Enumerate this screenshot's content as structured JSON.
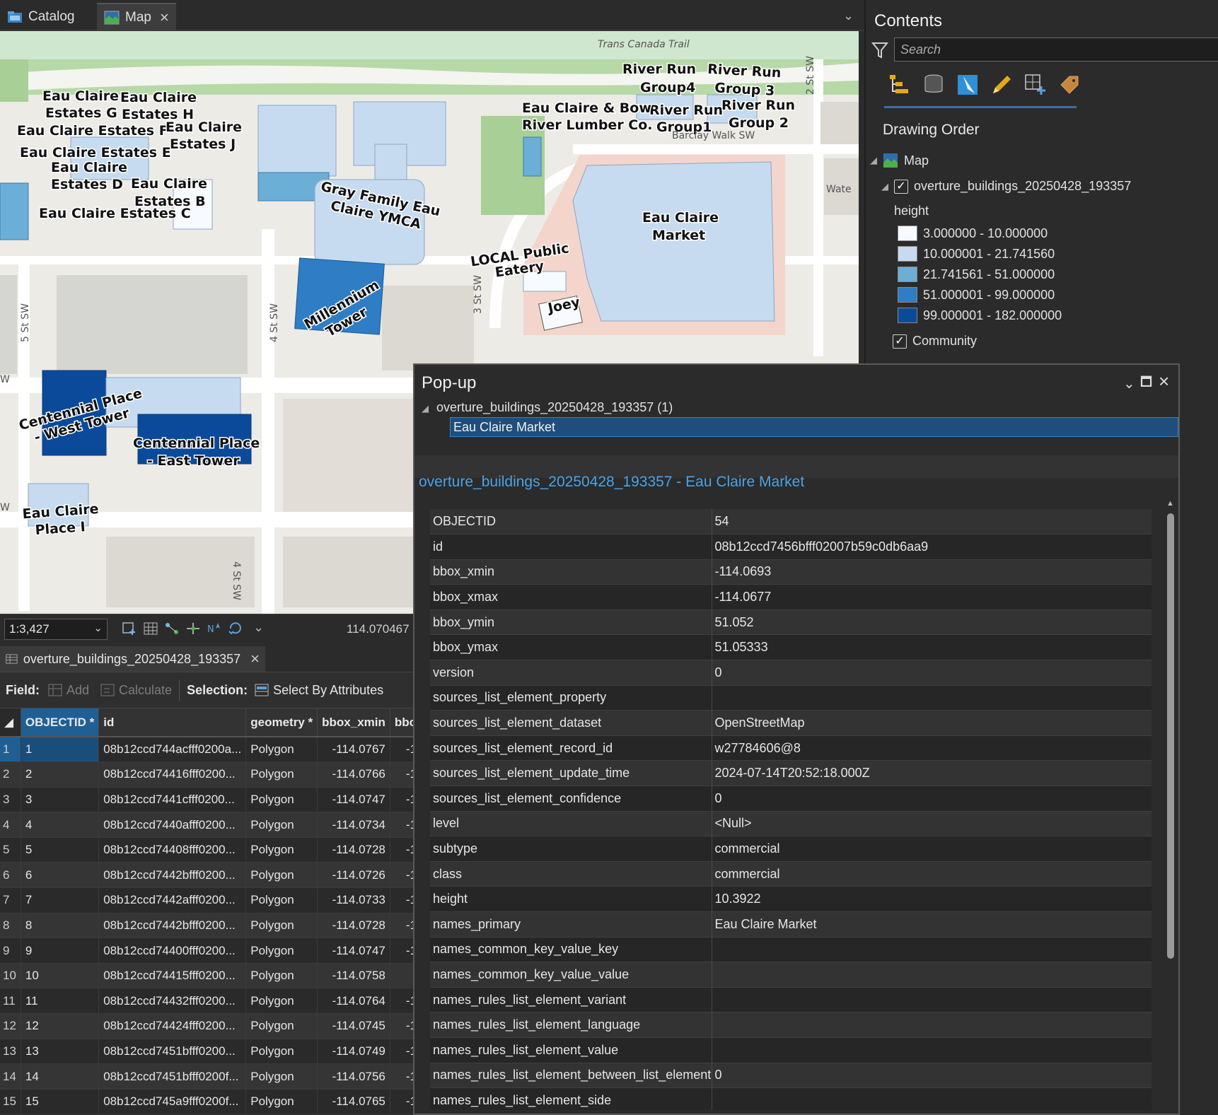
{
  "tabs": [
    {
      "label": "Catalog",
      "icon": "catalog-icon"
    },
    {
      "label": "Map",
      "icon": "map-icon",
      "active": true
    }
  ],
  "map": {
    "labels": {
      "trans_canada_trail": "Trans Canada Trail",
      "river_run_group4_a": "River Run",
      "river_run_group4_b": "Group4",
      "river_run_group3_a": "River Run",
      "river_run_group3_b": "Group 3",
      "river_run_group1_a": "River Run",
      "river_run_group1_b": "Group1",
      "river_run_group2_a": "River Run",
      "river_run_group2_b": "Group 2",
      "eau_claire_bow_a": "Eau Claire & Bow",
      "eau_claire_bow_b": "River Lumber Co.",
      "barclay_walk": "Barclay Walk SW",
      "st2": "2 St SW",
      "estates_g_a": "Eau Claire",
      "estates_g_b": "Estates G",
      "estates_h_a": "Eau Claire",
      "estates_h_b": "Estates H",
      "estates_f": "Eau Claire Estates F",
      "estates_j_a": "Eau Claire",
      "estates_j_b": "Estates J",
      "estates_e": "Eau Claire Estates E",
      "estates_d_a": "Eau Claire",
      "estates_d_b": "Estates D",
      "estates_b_a": "Eau Claire",
      "estates_b_b": "Estates B",
      "estates_c": "Eau Claire Estates C",
      "ymca_a": "Gray Family Eau",
      "ymca_b": "Claire YMCA",
      "market_a": "Eau Claire",
      "market_b": "Market",
      "wate": "Wate",
      "local_a": "LOCAL Public",
      "local_b": "Eatery",
      "joey": "Joey",
      "st5": "5 St SW",
      "st4": "4 St SW",
      "st3": "3 St SW",
      "millennium_a": "Millennium",
      "millennium_b": "Tower",
      "cp_west_a": "Centennial Place",
      "cp_west_b": "- West Tower",
      "cp_east_a": "Centennial Place",
      "cp_east_b": "- East Tower",
      "place_i_a": "Eau Claire",
      "place_i_b": "Place I",
      "st4b": "4 St SW",
      "w1": "W",
      "w2": "W"
    }
  },
  "status": {
    "scale": "1:3,427",
    "coordinate": "114.070467"
  },
  "table": {
    "tab_label": "overture_buildings_20250428_193357",
    "toolbar": {
      "field_label": "Field:",
      "add": "Add",
      "calculate": "Calculate",
      "selection_label": "Selection:",
      "select_by_attributes": "Select By Attributes"
    },
    "columns": [
      "OBJECTID *",
      "id",
      "geometry *",
      "bbox_xmin",
      "bbo"
    ],
    "rows": [
      {
        "n": "1",
        "oid": "1",
        "id": "08b12ccd744acfff0200a...",
        "geom": "Polygon",
        "xmin": "-114.0767",
        "next": "-1"
      },
      {
        "n": "2",
        "oid": "2",
        "id": "08b12ccd74416fff0200...",
        "geom": "Polygon",
        "xmin": "-114.0766",
        "next": "-1"
      },
      {
        "n": "3",
        "oid": "3",
        "id": "08b12ccd7441cfff0200...",
        "geom": "Polygon",
        "xmin": "-114.0747",
        "next": "-1"
      },
      {
        "n": "4",
        "oid": "4",
        "id": "08b12ccd7440afff0200...",
        "geom": "Polygon",
        "xmin": "-114.0734",
        "next": "-1"
      },
      {
        "n": "5",
        "oid": "5",
        "id": "08b12ccd74408fff0200...",
        "geom": "Polygon",
        "xmin": "-114.0728",
        "next": "-1"
      },
      {
        "n": "6",
        "oid": "6",
        "id": "08b12ccd7442bfff0200...",
        "geom": "Polygon",
        "xmin": "-114.0726",
        "next": "-1"
      },
      {
        "n": "7",
        "oid": "7",
        "id": "08b12ccd7442afff0200...",
        "geom": "Polygon",
        "xmin": "-114.0733",
        "next": "-1"
      },
      {
        "n": "8",
        "oid": "8",
        "id": "08b12ccd7442bfff0200...",
        "geom": "Polygon",
        "xmin": "-114.0728",
        "next": "-1"
      },
      {
        "n": "9",
        "oid": "9",
        "id": "08b12ccd74400fff0200...",
        "geom": "Polygon",
        "xmin": "-114.0747",
        "next": "-1"
      },
      {
        "n": "10",
        "oid": "10",
        "id": "08b12ccd74415fff0200...",
        "geom": "Polygon",
        "xmin": "-114.0758",
        "next": "-"
      },
      {
        "n": "11",
        "oid": "11",
        "id": "08b12ccd74432fff0200...",
        "geom": "Polygon",
        "xmin": "-114.0764",
        "next": "-1"
      },
      {
        "n": "12",
        "oid": "12",
        "id": "08b12ccd74424fff0200...",
        "geom": "Polygon",
        "xmin": "-114.0745",
        "next": "-1"
      },
      {
        "n": "13",
        "oid": "13",
        "id": "08b12ccd7451bfff0200...",
        "geom": "Polygon",
        "xmin": "-114.0749",
        "next": "-1"
      },
      {
        "n": "14",
        "oid": "14",
        "id": "08b12ccd7451bfff0200f...",
        "geom": "Polygon",
        "xmin": "-114.0756",
        "next": "-1"
      },
      {
        "n": "15",
        "oid": "15",
        "id": "08b12ccd745a9fff0200f...",
        "geom": "Polygon",
        "xmin": "-114.0765",
        "next": "-1"
      }
    ]
  },
  "contents": {
    "title": "Contents",
    "search_placeholder": "Search",
    "drawing_order": "Drawing Order",
    "map_item": "Map",
    "layer": "overture_buildings_20250428_193357",
    "field": "height",
    "legend": [
      {
        "label": "3.000000 - 10.000000",
        "color": "#f7fbff"
      },
      {
        "label": "10.000001 - 21.741560",
        "color": "#c6dbef"
      },
      {
        "label": "21.741561 - 51.000000",
        "color": "#6baed6"
      },
      {
        "label": "51.000001 - 99.000000",
        "color": "#2f7dc4"
      },
      {
        "label": "99.000001 - 182.000000",
        "color": "#0b4a9a"
      }
    ],
    "community": "Community"
  },
  "popup": {
    "title": "Pop-up",
    "tree_layer": "overture_buildings_20250428_193357 (1)",
    "selected_feature": "Eau Claire Market",
    "header_link": "overture_buildings_20250428_193357 - Eau Claire Market",
    "attributes": [
      {
        "k": "OBJECTID",
        "v": "54"
      },
      {
        "k": "id",
        "v": "08b12ccd7456bfff02007b59c0db6aa9"
      },
      {
        "k": "bbox_xmin",
        "v": "-114.0693"
      },
      {
        "k": "bbox_xmax",
        "v": "-114.0677"
      },
      {
        "k": "bbox_ymin",
        "v": "51.052"
      },
      {
        "k": "bbox_ymax",
        "v": "51.05333"
      },
      {
        "k": "version",
        "v": "0"
      },
      {
        "k": "sources_list_element_property",
        "v": ""
      },
      {
        "k": "sources_list_element_dataset",
        "v": "OpenStreetMap"
      },
      {
        "k": "sources_list_element_record_id",
        "v": "w27784606@8"
      },
      {
        "k": "sources_list_element_update_time",
        "v": "2024-07-14T20:52:18.000Z"
      },
      {
        "k": "sources_list_element_confidence",
        "v": "0"
      },
      {
        "k": "level",
        "v": "<Null>"
      },
      {
        "k": "subtype",
        "v": "commercial"
      },
      {
        "k": "class",
        "v": "commercial"
      },
      {
        "k": "height",
        "v": "10.3922"
      },
      {
        "k": "names_primary",
        "v": "Eau Claire Market"
      },
      {
        "k": "names_common_key_value_key",
        "v": ""
      },
      {
        "k": "names_common_key_value_value",
        "v": ""
      },
      {
        "k": "names_rules_list_element_variant",
        "v": ""
      },
      {
        "k": "names_rules_list_element_language",
        "v": ""
      },
      {
        "k": "names_rules_list_element_value",
        "v": ""
      },
      {
        "k": "names_rules_list_element_between_list_element",
        "v": "0"
      },
      {
        "k": "names_rules_list_element_side",
        "v": ""
      }
    ]
  }
}
